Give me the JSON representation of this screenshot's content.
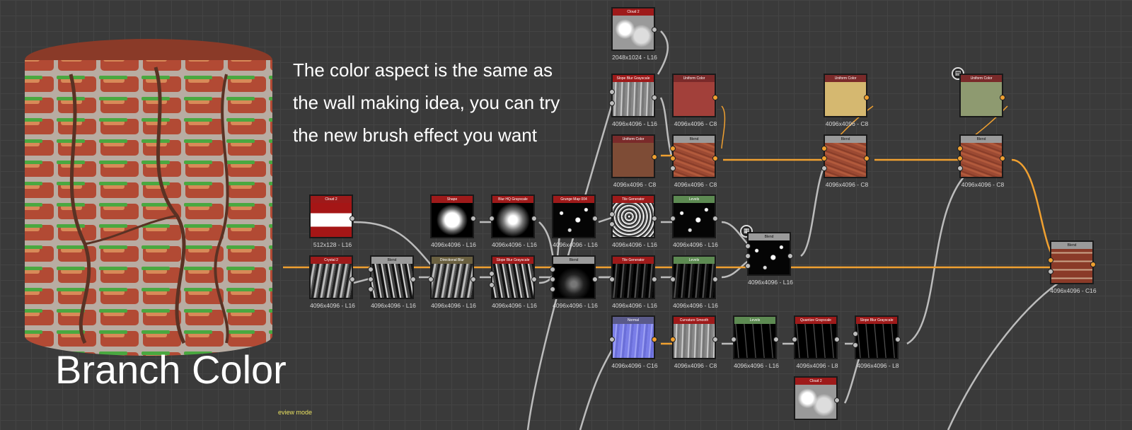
{
  "annotation": {
    "description": "The color aspect is the same as\nthe wall making idea, you can try\nthe new brush effect you want",
    "title": "Branch Color"
  },
  "status": {
    "mode_text": "eview mode"
  },
  "colors": {
    "main_wire": "#f0a030",
    "grid_bg": "#3a3a3a"
  },
  "nodes": {
    "cloud2_top": {
      "title": "Cloud 2",
      "res": "2048x1024 - L16"
    },
    "slope_blur_1": {
      "title": "Slope Blur Grayscale",
      "res": "4096x4096 - L16"
    },
    "uniform_red": {
      "title": "Uniform Color",
      "res": "4096x4096 - C8"
    },
    "uniform_yellow": {
      "title": "Uniform Color",
      "res": "4096x4096 - C8"
    },
    "uniform_sage": {
      "title": "Uniform Color",
      "res": ""
    },
    "uniform_brown": {
      "title": "Uniform Color",
      "res": "4096x4096 - C8"
    },
    "blend_1": {
      "title": "Blend",
      "res": "4096x4096 - C8"
    },
    "blend_2": {
      "title": "Blend",
      "res": "4096x4096 - C8"
    },
    "blend_3": {
      "title": "Blend",
      "res": "4096x4096 - C8"
    },
    "cloud2_left": {
      "title": "Cloud 2",
      "res": "512x128 - L16"
    },
    "shape": {
      "title": "Shape",
      "res": "4096x4096 - L16"
    },
    "blur_hq": {
      "title": "Blur HQ Grayscale",
      "res": "4096x4096 - L16"
    },
    "grunge_map": {
      "title": "Grunge Map 004",
      "res": "4096x4096 - L16"
    },
    "tile_gen_1": {
      "title": "Tile Generator",
      "res": "4096x4096 - L16"
    },
    "levels_1": {
      "title": "Levels",
      "res": "4096x4096 - L16"
    },
    "blend_mid": {
      "title": "Blend",
      "res": "4096x4096 - L16"
    },
    "crystal2": {
      "title": "Crystal 2",
      "res": "4096x4096 - L16"
    },
    "blend_gray_1": {
      "title": "Blend",
      "res": "4096x4096 - L16"
    },
    "directional_blur": {
      "title": "Directional Blur",
      "res": "4096x4096 - L16"
    },
    "slope_blur_2": {
      "title": "Slope Blur Grayscale",
      "res": "4096x4096 - L16"
    },
    "blend_gray_2": {
      "title": "Blend",
      "res": "4096x4096 - L16"
    },
    "tile_gen_2": {
      "title": "Tile Generator",
      "res": "4096x4096 - L16"
    },
    "levels_2": {
      "title": "Levels",
      "res": "4096x4096 - L16"
    },
    "final_blend": {
      "title": "Blend",
      "res": "4096x4096 - C16"
    },
    "normal": {
      "title": "Normal",
      "res": "4096x4096 - C16"
    },
    "curvature": {
      "title": "Curvature Smooth",
      "res": "4096x4096 - C8"
    },
    "levels_3": {
      "title": "Levels",
      "res": "4096x4096 - L16"
    },
    "quantize": {
      "title": "Quantize Grayscale",
      "res": "4096x4096 - L8"
    },
    "slope_blur_3": {
      "title": "Slope Blur Grayscale",
      "res": "4096x4096 - L8"
    },
    "cloud2_bottom": {
      "title": "Cloud 2",
      "res": ""
    }
  }
}
